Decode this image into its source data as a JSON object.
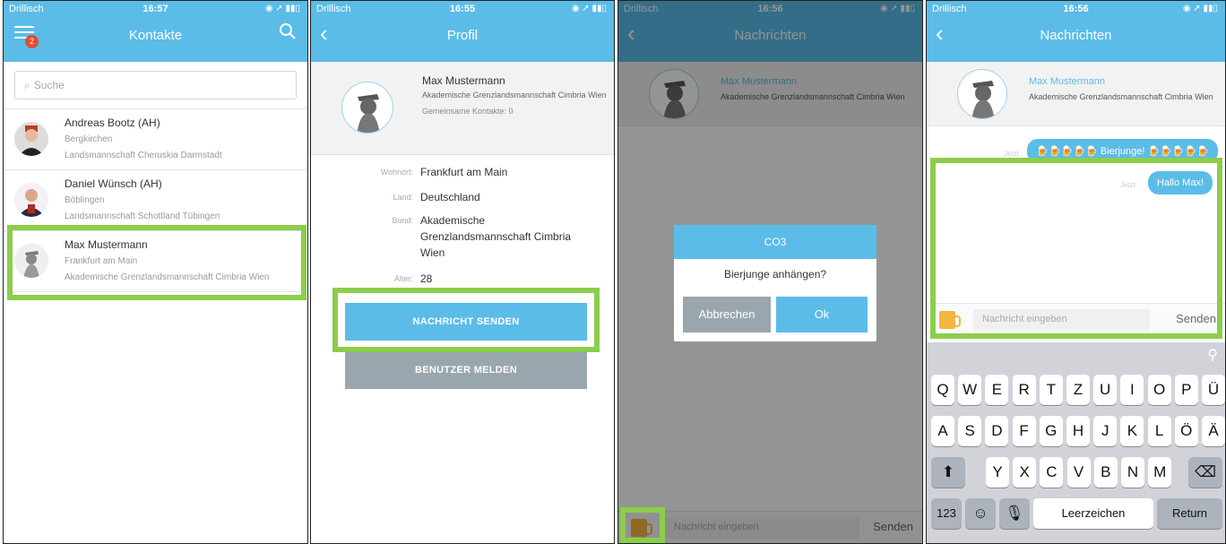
{
  "screens": {
    "s1": {
      "status": {
        "carrier": "Drillisch",
        "time": "16:57"
      },
      "nav": {
        "title": "Kontakte",
        "badge": "2"
      },
      "search": {
        "placeholder": "Suche"
      },
      "contacts": [
        {
          "name": "Andreas Bootz (AH)",
          "city": "Bergkirchen",
          "org": "Landsmannschaft Cheruskia Darmstadt"
        },
        {
          "name": "Daniel Wünsch (AH)",
          "city": "Böblingen",
          "org": "Landsmannschaft Schottland Tübingen"
        },
        {
          "name": "Max Mustermann",
          "city": "Frankfurt am Main",
          "org": "Akademische Grenzlandsmannschaft Cimbria Wien"
        }
      ]
    },
    "s2": {
      "status": {
        "carrier": "Drillisch",
        "time": "16:55"
      },
      "nav": {
        "title": "Profil"
      },
      "profile": {
        "name": "Max Mustermann",
        "org": "Akademische Grenzlandsmannschaft Cimbria Wien",
        "mutual": "Gemeinsame Kontakte: 0"
      },
      "fields": {
        "wohnort_label": "Wohnort:",
        "wohnort": "Frankfurt am Main",
        "land_label": "Land:",
        "land": "Deutschland",
        "bund_label": "Bund:",
        "bund1": "Akademische",
        "bund2": "Grenzlandsmannschaft Cimbria",
        "bund3": "Wien",
        "alter_label": "Alter:",
        "alter": "28"
      },
      "buttons": {
        "send": "NACHRICHT SENDEN",
        "report": "BENUTZER MELDEN"
      }
    },
    "s3": {
      "status": {
        "carrier": "Drillisch",
        "time": "16:56"
      },
      "nav": {
        "title": "Nachrichten"
      },
      "chat": {
        "name": "Max Mustermann",
        "org": "Akademische Grenzlandsmannschaft Cimbria Wien"
      },
      "dialog": {
        "title": "CO3",
        "message": "Bierjunge anhängen?",
        "cancel": "Abbrechen",
        "ok": "Ok"
      },
      "input": {
        "placeholder": "Nachricht eingeben",
        "send": "Senden"
      }
    },
    "s4": {
      "status": {
        "carrier": "Drillisch",
        "time": "16:56"
      },
      "nav": {
        "title": "Nachrichten"
      },
      "chat": {
        "name": "Max Mustermann",
        "org": "Akademische Grenzlandsmannschaft Cimbria Wien"
      },
      "messages": [
        {
          "time": "Jetzt",
          "text": "🍺🍺🍺🍺🍺 Bierjunge! 🍺🍺🍺🍺🍺"
        },
        {
          "time": "Jetzt",
          "text": "Hallo Max!"
        }
      ],
      "input": {
        "placeholder": "Nachricht eingeben",
        "send": "Senden"
      },
      "keyboard": {
        "row1": [
          "Q",
          "W",
          "E",
          "R",
          "T",
          "Z",
          "U",
          "I",
          "O",
          "P",
          "Ü"
        ],
        "row2": [
          "A",
          "S",
          "D",
          "F",
          "G",
          "H",
          "J",
          "K",
          "L",
          "Ö",
          "Ä"
        ],
        "row3": [
          "Y",
          "X",
          "C",
          "V",
          "B",
          "N",
          "M"
        ],
        "numbers": "123",
        "space": "Leerzeichen",
        "return": "Return"
      }
    }
  },
  "colors": {
    "accent": "#5bbce8",
    "highlight": "#8ccd4b",
    "badge": "#e34b32",
    "gray_button": "#9aa6ae"
  }
}
